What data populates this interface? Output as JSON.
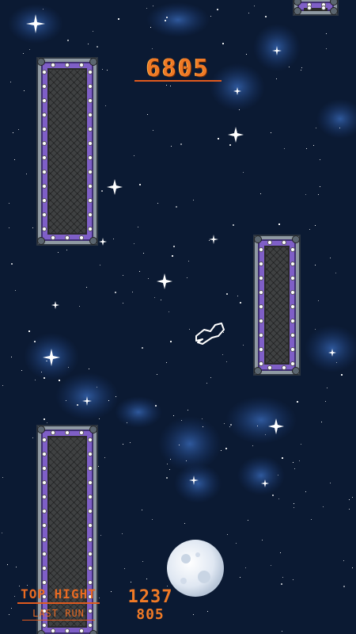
{
  "hud": {
    "score": "6805",
    "top_hight_label": "TOP HIGHT",
    "top_hight_value": "1237",
    "last_run_label": "LAST RUN",
    "last_run_value": "805"
  },
  "colors": {
    "background": "#0b1a33",
    "score_orange": "#f07a26",
    "pillar_purple": "#7f5fc7",
    "pillar_metal": "#8f9aa3"
  },
  "icons": {
    "player": "astronaut-icon",
    "planet": "moon-icon",
    "stars": "star-icon"
  }
}
